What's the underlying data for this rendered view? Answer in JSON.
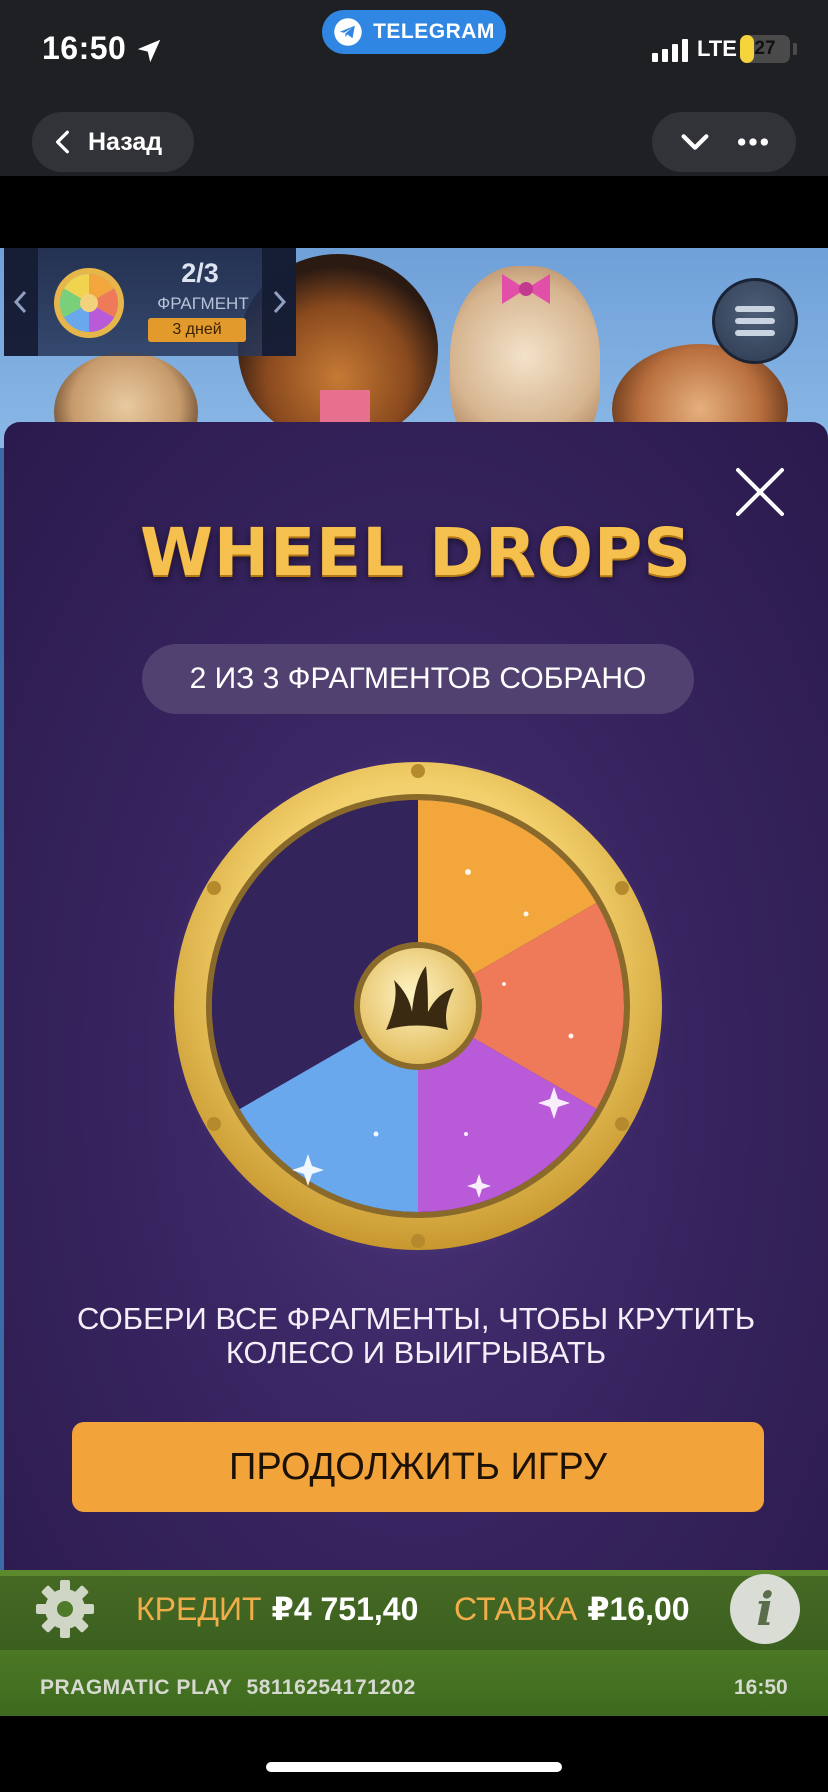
{
  "status_bar": {
    "time": "16:50",
    "network": "LTE",
    "battery_level": "27",
    "battery_fraction": 0.27,
    "location_icon": "location-arrow-icon"
  },
  "telegram": {
    "pill_label": "TELEGRAM",
    "back_label": "Назад",
    "icons": [
      "chevron-left-icon",
      "chevron-down-icon",
      "more-dots-icon",
      "telegram-plane-icon"
    ]
  },
  "game": {
    "fragment_panel": {
      "count": "2/3",
      "label": "ФРАГМЕНТ",
      "days": "3 дней"
    },
    "modal": {
      "title": "WHEEL DROPS",
      "progress": "2 ИЗ 3 ФРАГМЕНТОВ СОБРАНО",
      "description_line1": "СОБЕРИ ВСЕ ФРАГМЕНТЫ, ЧТОБЫ КРУТИТЬ",
      "description_line2": "КОЛЕСО И ВЫИГРЫВАТЬ",
      "continue_label": "ПРОДОЛЖИТЬ ИГРУ"
    },
    "bottom_bar": {
      "credit_label": "КРЕДИТ",
      "credit_value": "₽4 751,40",
      "stake_label": "СТАВКА",
      "stake_value": "₽16,00",
      "info_symbol": "i"
    },
    "footer": {
      "provider": "PRAGMATIC PLAY",
      "session_id": "58116254171202",
      "time": "16:50"
    }
  },
  "colors": {
    "telegram_blue": "#2f87e3",
    "modal_bg": "#3a2663",
    "title_gold": "#f6c04f",
    "button_orange": "#f2a33a",
    "label_orange": "#f0ad4a",
    "wheel_orange": "#f2a63b",
    "wheel_red": "#ee7a5a",
    "wheel_purple": "#b95bd8",
    "wheel_blue": "#6aa8ee"
  }
}
